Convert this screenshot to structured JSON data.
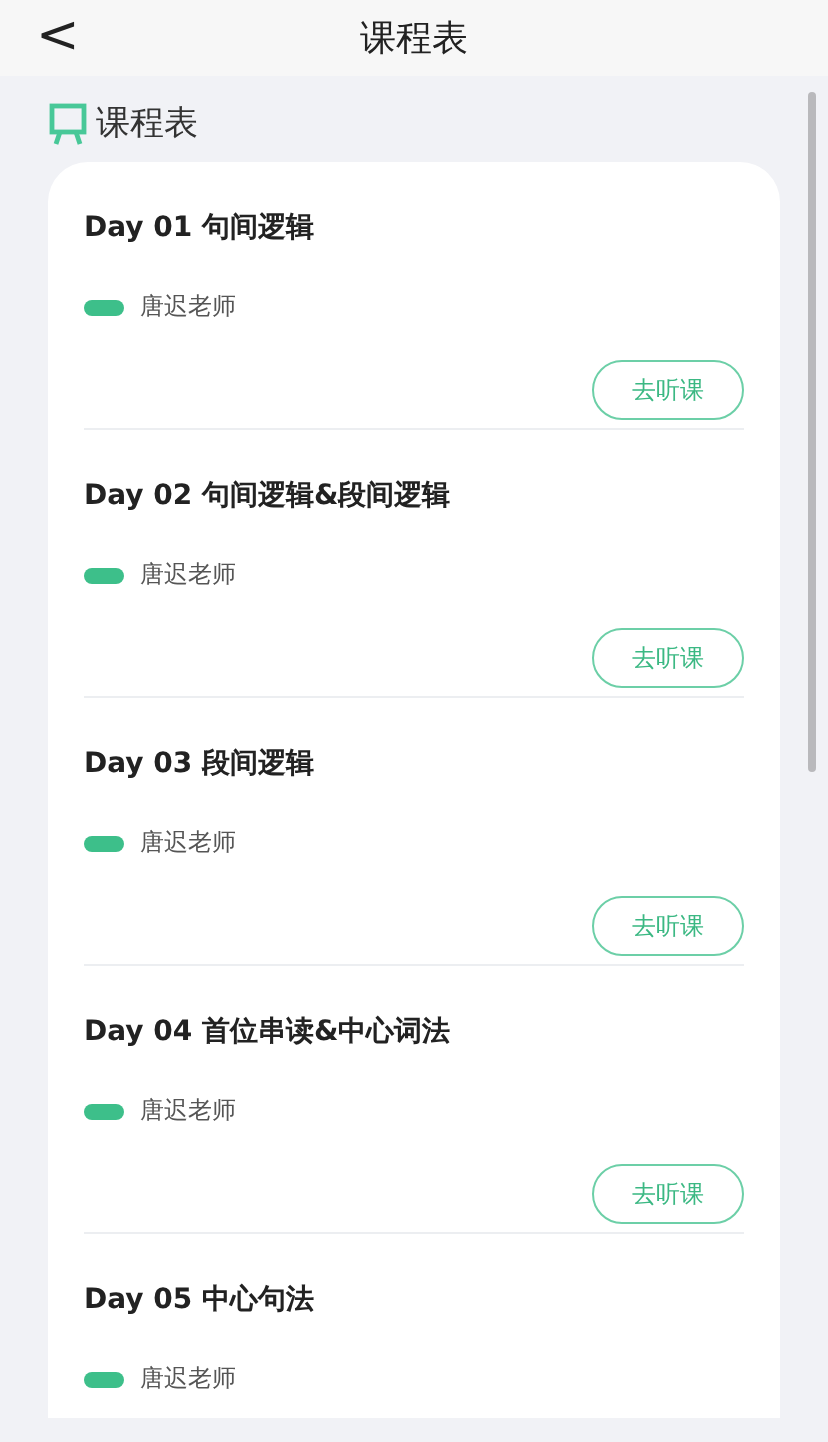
{
  "header": {
    "back": "<",
    "title": "课程表"
  },
  "section": {
    "title": "课程表"
  },
  "lessons": [
    {
      "title": "Day 01 句间逻辑",
      "teacher": "唐迟老师",
      "button": "去听课"
    },
    {
      "title": "Day 02 句间逻辑&段间逻辑",
      "teacher": "唐迟老师",
      "button": "去听课"
    },
    {
      "title": "Day 03 段间逻辑",
      "teacher": "唐迟老师",
      "button": "去听课"
    },
    {
      "title": "Day 04 首位串读&中心词法",
      "teacher": "唐迟老师",
      "button": "去听课"
    },
    {
      "title": "Day 05 中心句法",
      "teacher": "唐迟老师"
    }
  ]
}
